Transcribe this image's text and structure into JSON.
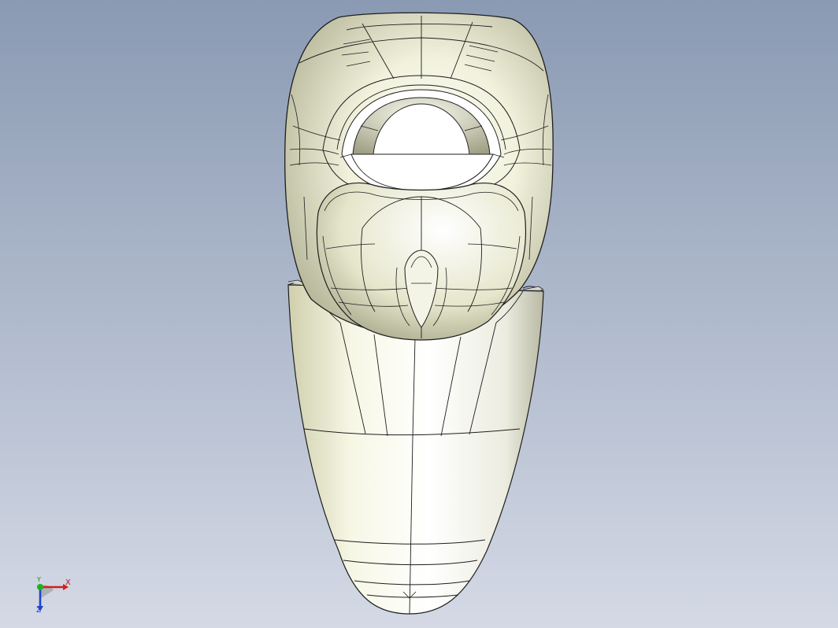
{
  "scene": {
    "background_top": "#8c9cb4",
    "background_bottom": "#d3d8e4",
    "model_fill": "#f2f2de",
    "model_shade": "#b9b99c",
    "edge_color": "#1e1e1e"
  },
  "triad": {
    "x_label": "X",
    "y_label": "Y",
    "z_label": "Z",
    "x_color": "#d21e1e",
    "y_color": "#1fb01f",
    "z_color": "#1f44d0"
  }
}
